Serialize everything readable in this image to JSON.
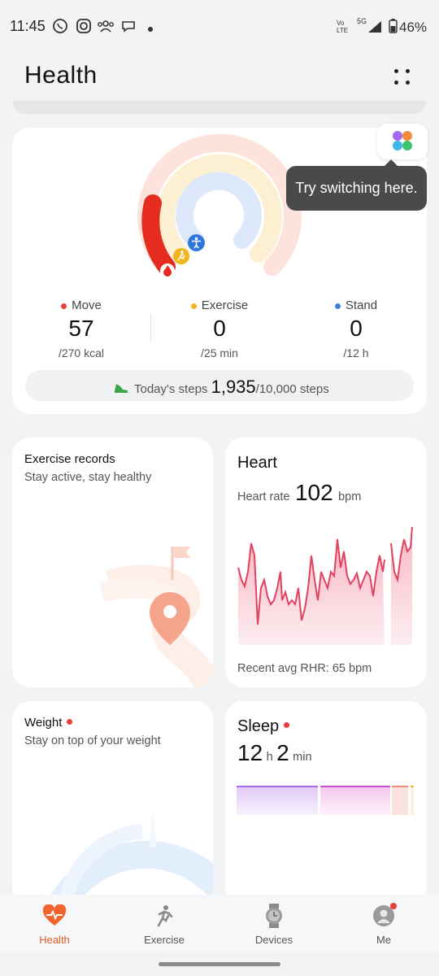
{
  "status_bar": {
    "time": "11:45",
    "network": "5G",
    "lte": "Vo LTE",
    "battery": "46%"
  },
  "header": {
    "title": "Health"
  },
  "activity": {
    "tooltip": "Try switching here.",
    "move": {
      "label": "Move",
      "value": "57",
      "goal": "/270 kcal",
      "color": "#e8403a"
    },
    "exercise": {
      "label": "Exercise",
      "value": "0",
      "goal": "/25 min",
      "color": "#f2b51f"
    },
    "stand": {
      "label": "Stand",
      "value": "0",
      "goal": "/12 h",
      "color": "#3d7fe0"
    },
    "steps": {
      "prefix": "Today's steps",
      "value": "1,935",
      "goal": "/10,000 steps"
    }
  },
  "exercise_card": {
    "title": "Exercise records",
    "subtitle": "Stay active, stay healthy"
  },
  "heart_card": {
    "title": "Heart",
    "rate_label": "Heart rate",
    "rate_value": "102",
    "rate_unit": "bpm",
    "footer": "Recent avg RHR: 65 bpm"
  },
  "weight_card": {
    "title": "Weight",
    "subtitle": "Stay on top of your weight"
  },
  "sleep_card": {
    "title": "Sleep",
    "hours": "12",
    "h_unit": "h",
    "minutes": "2",
    "min_unit": "min"
  },
  "bottom_nav": {
    "items": [
      {
        "label": "Health",
        "icon": "heart-pulse-icon",
        "active": true
      },
      {
        "label": "Exercise",
        "icon": "running-icon",
        "active": false
      },
      {
        "label": "Devices",
        "icon": "watch-icon",
        "active": false
      },
      {
        "label": "Me",
        "icon": "profile-icon",
        "active": false
      }
    ]
  },
  "colors": {
    "accent": "#e25c27",
    "heart_line": "#e4405f",
    "sleep_purple": "#b057e0"
  }
}
